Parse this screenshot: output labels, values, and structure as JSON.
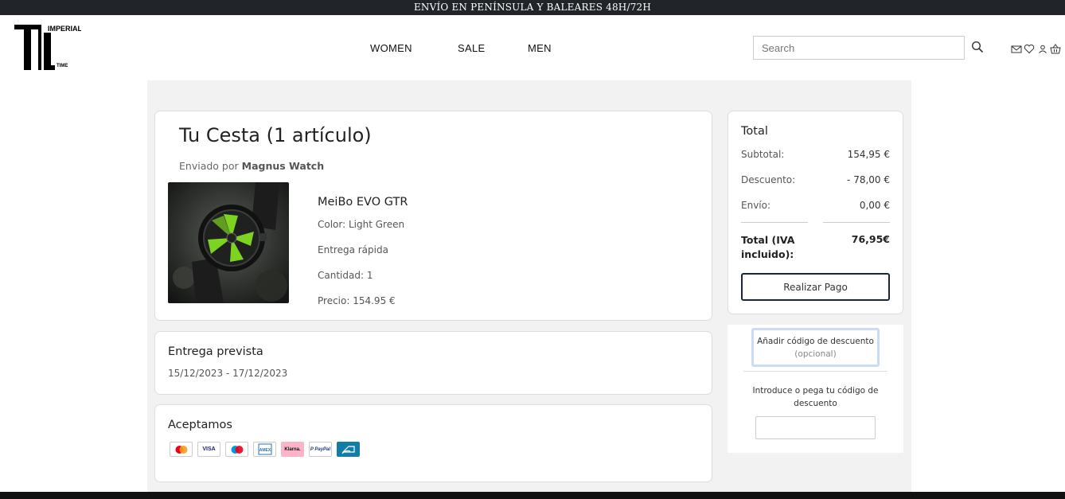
{
  "announcement": "ENVÍO EN PENÍNSULA Y BALEARES 48H/72H",
  "logo": {
    "word_top": "IMPERIAL",
    "word_bottom": "TIME"
  },
  "nav": {
    "women": "WOMEN",
    "sale": "SALE",
    "men": "MEN"
  },
  "search": {
    "placeholder": "Search"
  },
  "header_icons": [
    "mail-icon",
    "heart-icon",
    "user-icon",
    "basket-icon"
  ],
  "cart": {
    "title": "Tu Cesta (1 artículo)",
    "sent_by_prefix": "Enviado por",
    "seller": "Magnus Watch",
    "product": {
      "name": "MeiBo EVO GTR",
      "color": "Color: Light Green",
      "delivery": "Entrega rápida",
      "quantity": "Cantidad: 1",
      "price": "Precio: 154.95 €"
    }
  },
  "delivery": {
    "title": "Entrega prevista",
    "dates": "15/12/2023 - 17/12/2023"
  },
  "accept": {
    "title": "Aceptamos",
    "methods": [
      "Mastercard",
      "VISA",
      "Maestro",
      "American Express",
      "Klarna",
      "PayPal",
      "Bank transfer"
    ]
  },
  "totals": {
    "title": "Total",
    "subtotal_label": "Subtotal:",
    "subtotal_value": "154,95 €",
    "discount_label": "Descuento:",
    "discount_value": "- 78,00 €",
    "shipping_label": "Envío:",
    "shipping_value": "0,00 €",
    "total_label": "Total (IVA incluido):",
    "total_value": "76,95€",
    "pay_button": "Realizar Pago"
  },
  "discount": {
    "button_main": "Añadir código de descuento",
    "button_optional": "(opcional)",
    "hint": "Introduce o pega tu código de descuento",
    "input_value": ""
  },
  "colors": {
    "announce_bg": "#212529",
    "panel_bg": "#f2f2f2",
    "button_border": "#1a2540",
    "accent_green": "#7ed321"
  }
}
